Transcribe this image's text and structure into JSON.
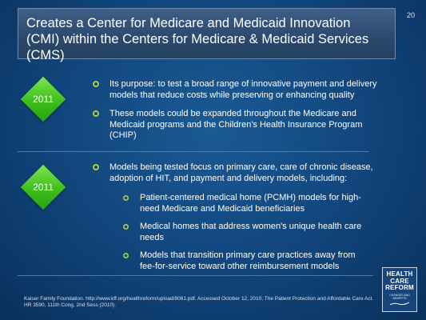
{
  "slide_number": "20",
  "title": "Creates a Center for Medicare and Medicaid Innovation (CMI) within the Centers for Medicare & Medicaid Services (CMS)",
  "sections": [
    {
      "year": "2011",
      "bullets": [
        "Its purpose: to test a broad range of innovative payment and delivery models that reduce costs while preserving or enhancing quality",
        "These models could be expanded throughout the Medicare and Medicaid programs and  the Children's Health Insurance Program (CHIP)"
      ]
    },
    {
      "year": "2011",
      "bullets": [
        "Models being tested focus on primary care, care of chronic disease, adoption of HIT, and payment and delivery models, including:"
      ],
      "subbullets": [
        "Patient-centered medical home (PCMH) models for high-need Medicare and Medicaid beneficiaries",
        "Medical homes that address women's unique health care needs",
        "Models that transition primary care practices away from fee-for-service toward other reimbursement models"
      ]
    }
  ],
  "footer": "Kaiser Family Foundation. http://www.kff.org/healthreform/upload/8061.pdf. Accessed October 12, 2010; The Patient Protection and Affordable Care Act. HR 3590, 111th Cong, 2nd Sess (2010).",
  "logo": {
    "line1": "HEALTH",
    "line2": "CARE",
    "line3": "REFORM",
    "tagline": "CHANGES AND BENEFITS"
  }
}
